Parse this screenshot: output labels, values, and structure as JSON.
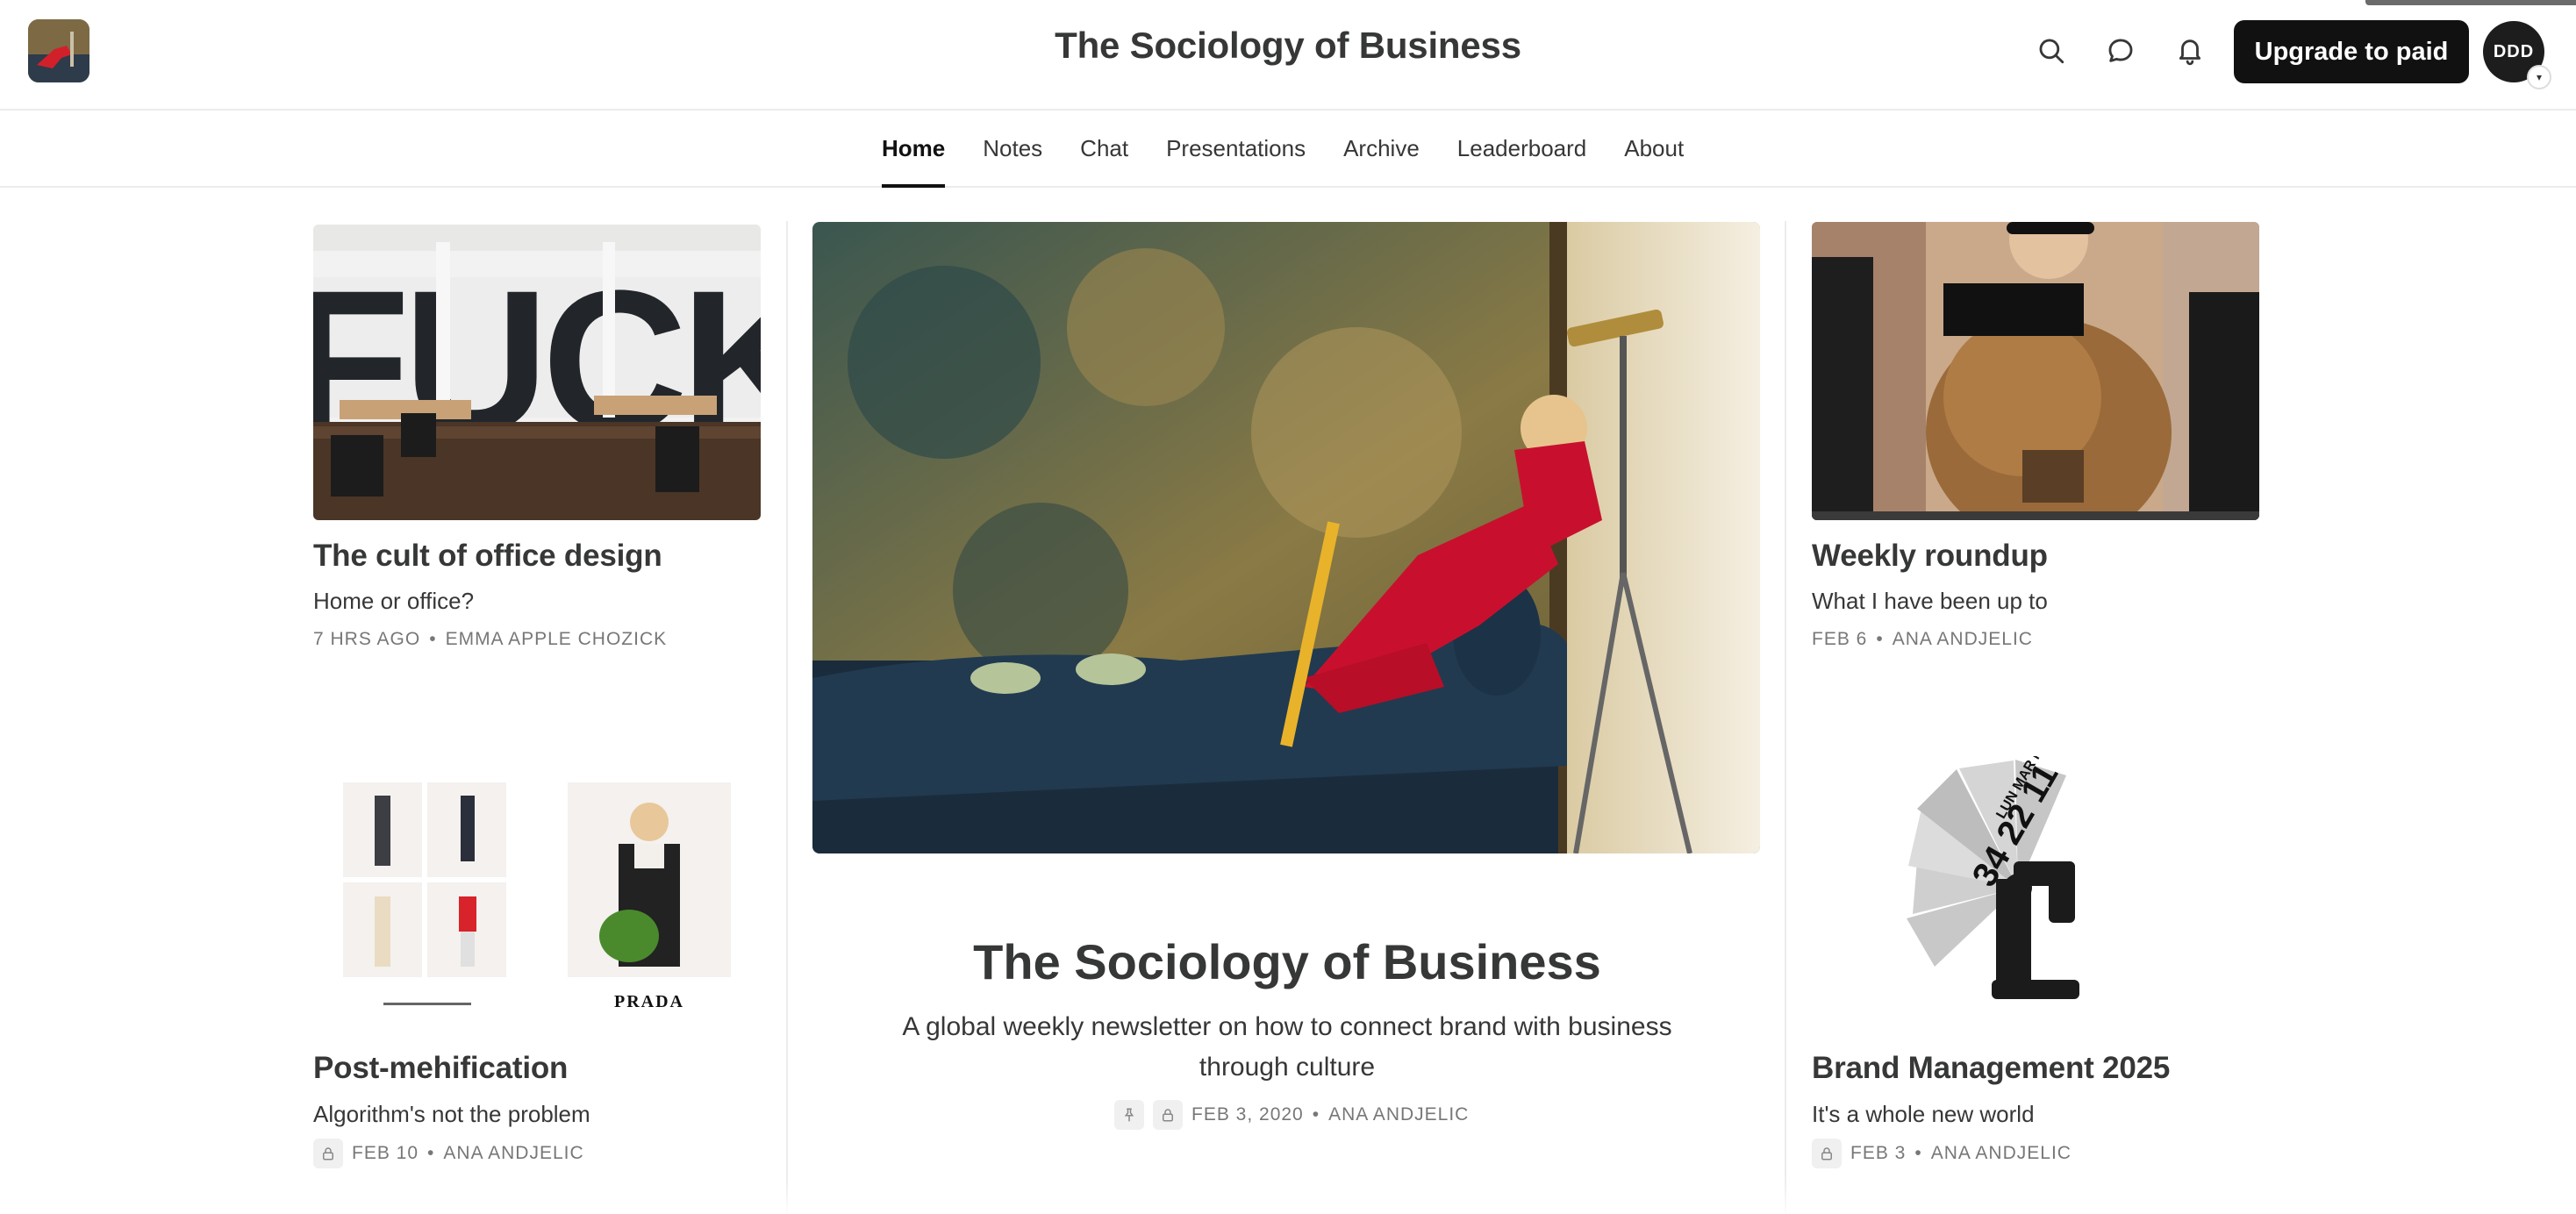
{
  "header": {
    "title": "The Sociology of Business",
    "upgrade_label": "Upgrade to paid",
    "avatar_text": "DDD"
  },
  "nav": {
    "items": [
      {
        "label": "Home",
        "active": true
      },
      {
        "label": "Notes"
      },
      {
        "label": "Chat"
      },
      {
        "label": "Presentations"
      },
      {
        "label": "Archive"
      },
      {
        "label": "Leaderboard"
      },
      {
        "label": "About"
      }
    ]
  },
  "posts": {
    "office": {
      "title": "The cult of office design",
      "subtitle": "Home or office?",
      "date": "7 HRS AGO",
      "author": "EMMA APPLE CHOZICK",
      "image_text": "FUCK"
    },
    "weekly": {
      "title": "Weekly roundup",
      "subtitle": "What I have been up to",
      "date": "FEB 6",
      "author": "ANA ANDJELIC"
    },
    "meh": {
      "title": "Post-mehification",
      "subtitle": "Algorithm's not the problem",
      "date": "FEB 10",
      "author": "ANA ANDJELIC",
      "image_caption": "PRADA"
    },
    "brand": {
      "title": "Brand Management 2025",
      "subtitle": "It's a whole new world",
      "date": "FEB 3",
      "author": "ANA ANDJELIC",
      "image_text_big": "34 22 11",
      "image_text_small": "LUN MAR MER"
    }
  },
  "hero": {
    "title": "The Sociology of Business",
    "subtitle": "A global weekly newsletter on how to connect brand with business through culture",
    "date": "FEB 3, 2020",
    "author": "ANA ANDJELIC"
  },
  "meta_separator": "•",
  "icons": [
    "search-icon",
    "chat-bubble-icon",
    "bell-icon",
    "lock-icon",
    "pin-icon",
    "chevron-down-icon"
  ]
}
